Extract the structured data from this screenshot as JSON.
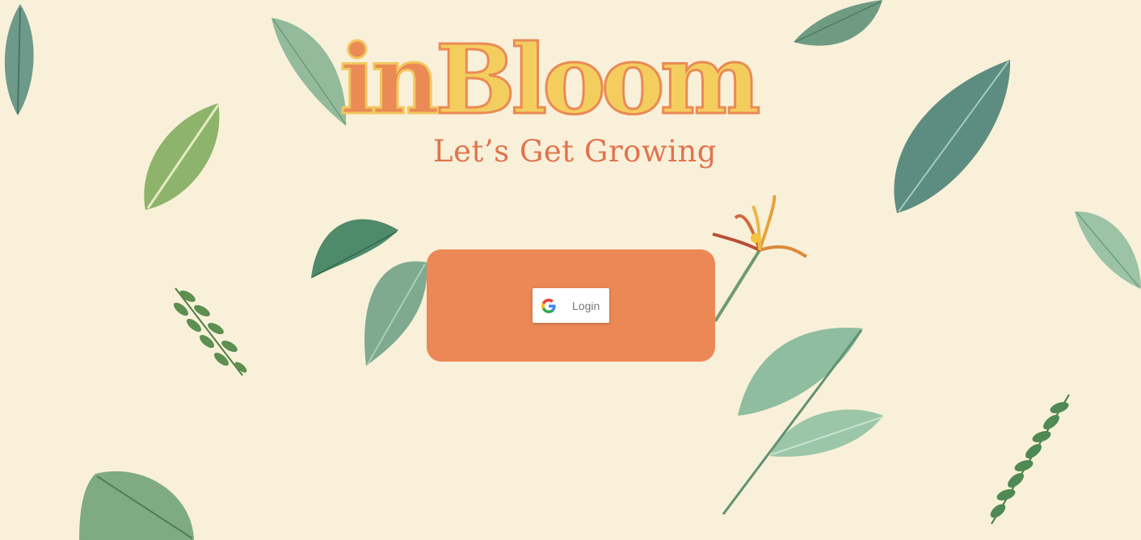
{
  "logo": {
    "word_part_a": "in",
    "word_part_b": "Bloom",
    "tagline": "Let’s Get Growing"
  },
  "login": {
    "button_label": "Login",
    "provider_icon": "google-icon"
  },
  "colors": {
    "background": "#f9f0d9",
    "card": "#eb8855",
    "logo_orange": "#ea8a55",
    "logo_yellow": "#f3ce5e",
    "tagline": "#e0744e",
    "leaf_green": "#7fae8e"
  }
}
